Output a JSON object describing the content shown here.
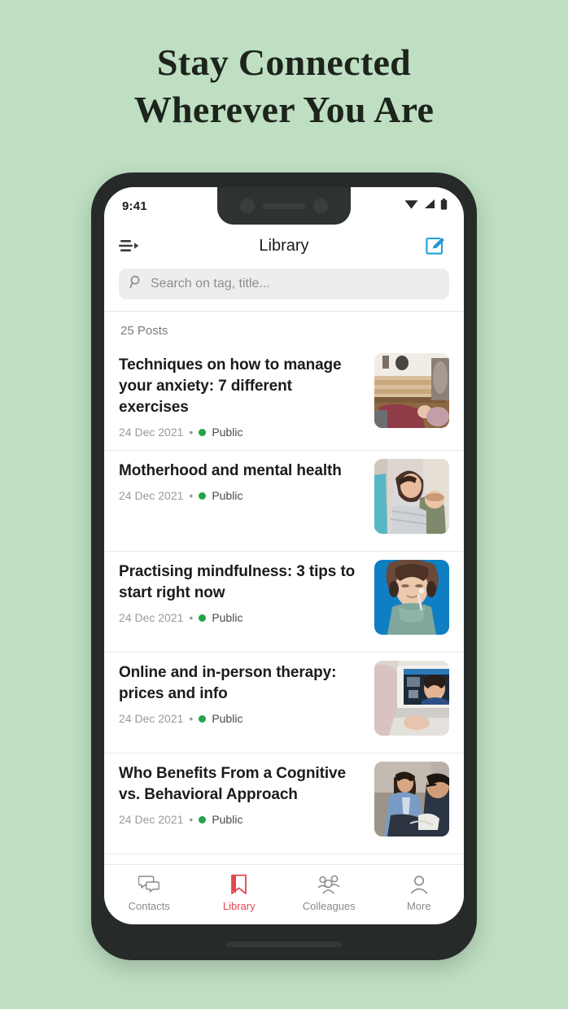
{
  "promo": {
    "headline_line1": "Stay Connected",
    "headline_line2": "Wherever You Are",
    "background_color": "#bedfc2",
    "text_color": "#1d241c"
  },
  "device": {
    "frame_color": "#262a28",
    "screen_color": "#ffffff"
  },
  "status_bar": {
    "time": "9:41",
    "icons": [
      "wifi-icon",
      "cellular-signal-icon",
      "battery-icon"
    ]
  },
  "app_bar": {
    "title": "Library",
    "menu_icon": "menu-arrow-icon",
    "compose_icon": "compose-icon",
    "compose_color": "#1e9fd8"
  },
  "search": {
    "placeholder": "Search on tag, title...",
    "value": "",
    "icon": "search-icon",
    "background": "#ededed"
  },
  "list_header": {
    "posts_count": "25 Posts"
  },
  "posts": [
    {
      "title": "Techniques on how to manage your anxiety: 7 different exercises",
      "date": "24 Dec 2021",
      "separator": "•",
      "visibility": "Public",
      "status_color": "#22a447",
      "thumbnail": "yoga-studio-floor-photo"
    },
    {
      "title": "Motherhood and mental health",
      "date": "24 Dec 2021",
      "separator": "•",
      "visibility": "Public",
      "status_color": "#22a447",
      "thumbnail": "mother-holding-baby-photo"
    },
    {
      "title": "Practising mindfulness: 3 tips to start right now",
      "date": "24 Dec 2021",
      "separator": "•",
      "visibility": "Public",
      "status_color": "#22a447",
      "thumbnail": "woman-eyes-closed-blue-background-photo"
    },
    {
      "title": "Online and in-person therapy: prices and info",
      "date": "24 Dec 2021",
      "separator": "•",
      "visibility": "Public",
      "status_color": "#22a447",
      "thumbnail": "video-call-laptop-photo"
    },
    {
      "title": "Who Benefits From a Cognitive vs. Behavioral Approach",
      "date": "24 Dec 2021",
      "separator": "•",
      "visibility": "Public",
      "status_color": "#22a447",
      "thumbnail": "therapy-session-two-men-photo"
    }
  ],
  "bottom_nav": {
    "active_color": "#e2484f",
    "inactive_color": "#8a8a8a",
    "items": [
      {
        "label": "Contacts",
        "icon": "chat-bubbles-icon",
        "active": false
      },
      {
        "label": "Library",
        "icon": "bookmark-icon",
        "active": true
      },
      {
        "label": "Colleagues",
        "icon": "people-group-icon",
        "active": false
      },
      {
        "label": "More",
        "icon": "person-icon",
        "active": false
      }
    ]
  }
}
